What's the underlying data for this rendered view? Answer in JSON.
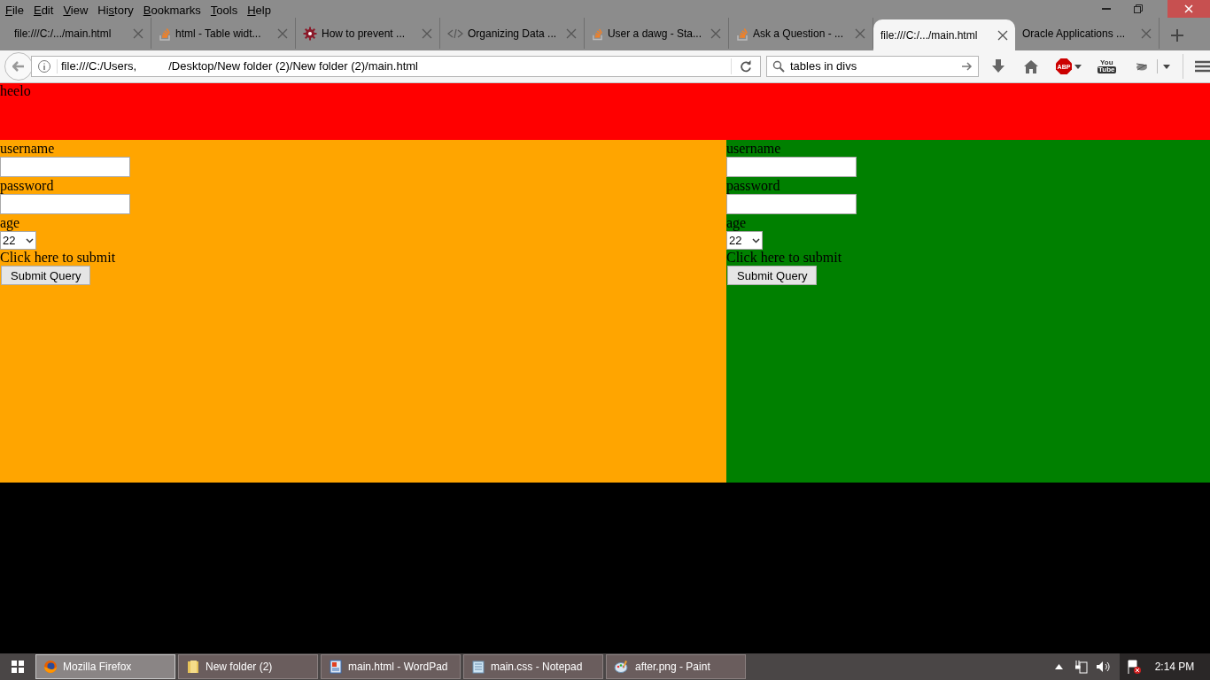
{
  "menu": [
    {
      "key": "F",
      "rest": "ile"
    },
    {
      "key": "E",
      "rest": "dit"
    },
    {
      "key": "V",
      "rest": "iew"
    },
    {
      "before": "Hi",
      "key": "s",
      "rest": "tory"
    },
    {
      "key": "B",
      "rest": "ookmarks"
    },
    {
      "key": "T",
      "rest": "ools"
    },
    {
      "key": "H",
      "rest": "elp"
    }
  ],
  "tabs": [
    {
      "label": "file:///C:/.../main.html",
      "kind": "none",
      "selected": false
    },
    {
      "label": "html - Table widt...",
      "kind": "stack",
      "selected": false
    },
    {
      "label": "How to prevent ...",
      "kind": "gear",
      "selected": false
    },
    {
      "label": "Organizing Data ...",
      "kind": "code",
      "selected": false
    },
    {
      "label": "User a dawg - Sta...",
      "kind": "stack",
      "selected": false
    },
    {
      "label": "Ask a Question - ...",
      "kind": "stack",
      "selected": false
    },
    {
      "label": "file:///C:/.../main.html",
      "kind": "none",
      "selected": true
    },
    {
      "label": "Oracle Applications ...",
      "kind": "none",
      "selected": false
    }
  ],
  "address": {
    "start": "file:///C:/Users,",
    "end": "/Desktop/New folder (2)/New folder (2)/main.html"
  },
  "search": {
    "value": "tables in divs"
  },
  "toolbar": {
    "abp": "ABP",
    "youtube_top": "You",
    "youtube_bottom": "Tube"
  },
  "page": {
    "header": "heelo",
    "panels": [
      {
        "color": "#ffa500",
        "fields": [
          {
            "label": "username",
            "kind": "text"
          },
          {
            "label": "password",
            "kind": "text"
          },
          {
            "label": "age",
            "kind": "select",
            "value": "22"
          }
        ],
        "submit_label": "Click here to submit",
        "button": "Submit Query"
      },
      {
        "color": "#008000",
        "fields": [
          {
            "label": "username",
            "kind": "text"
          },
          {
            "label": "password",
            "kind": "text"
          },
          {
            "label": "age",
            "kind": "select",
            "value": "22"
          }
        ],
        "submit_label": "Click here to submit",
        "button": "Submit Query"
      }
    ]
  },
  "taskbar": {
    "items": [
      {
        "label": "Mozilla Firefox",
        "kind": "firefox",
        "selected": true
      },
      {
        "label": "New folder (2)",
        "kind": "folder",
        "selected": false
      },
      {
        "label": "main.html - WordPad",
        "kind": "wordpad",
        "selected": false
      },
      {
        "label": "main.css - Notepad",
        "kind": "notepad",
        "selected": false
      },
      {
        "label": "after.png - Paint",
        "kind": "paint",
        "selected": false
      }
    ],
    "time": "2:14 PM"
  }
}
